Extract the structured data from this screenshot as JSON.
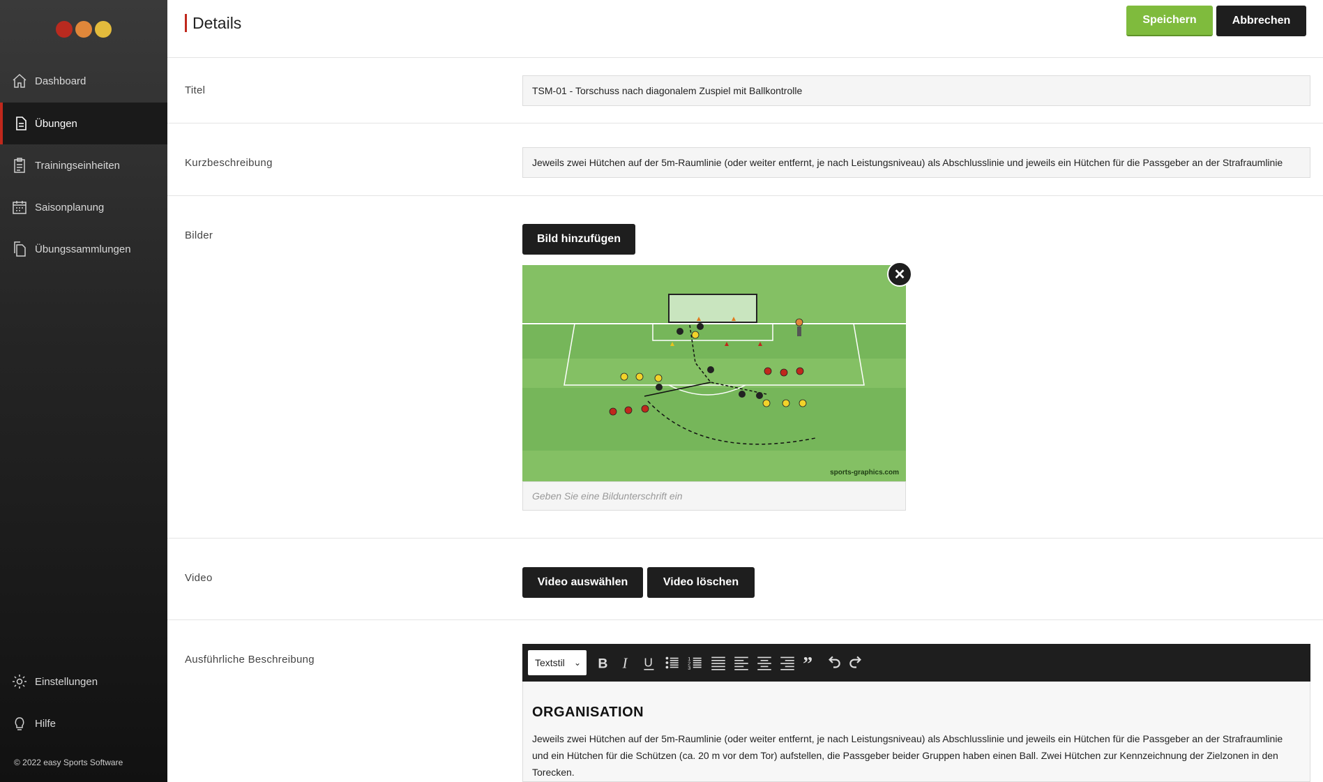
{
  "brand": {
    "logo_colors": [
      "#c0281c",
      "#e8893a",
      "#e7bd3a"
    ],
    "accent": "#c0281c",
    "save_color": "#7fbb3d"
  },
  "sidebar": {
    "items": [
      {
        "label": "Dashboard",
        "icon": "home-icon"
      },
      {
        "label": "Übungen",
        "icon": "document-icon",
        "active": true
      },
      {
        "label": "Trainingseinheiten",
        "icon": "clipboard-icon"
      },
      {
        "label": "Saisonplanung",
        "icon": "calendar-icon"
      },
      {
        "label": "Übungssammlungen",
        "icon": "copy-icon"
      }
    ],
    "bottom_items": [
      {
        "label": "Einstellungen",
        "icon": "gear-icon"
      },
      {
        "label": "Hilfe",
        "icon": "lightbulb-icon"
      }
    ],
    "footer": "© 2022 easy Sports Software"
  },
  "header": {
    "title": "Details",
    "save_label": "Speichern",
    "cancel_label": "Abbrechen"
  },
  "form": {
    "title_label": "Titel",
    "title_value": "TSM-01 - Torschuss nach diagonalem Zuspiel mit Ballkontrolle",
    "short_label": "Kurzbeschreibung",
    "short_value": "Jeweils zwei Hütchen auf der 5m-Raumlinie (oder weiter entfernt, je nach Leistungsniveau) als Abschlusslinie und jeweils ein Hütchen für die Passgeber an der Strafraumlinie",
    "images_label": "Bilder",
    "add_image_label": "Bild hinzufügen",
    "image_watermark": "sports-graphics.com",
    "caption_placeholder": "Geben Sie eine Bildunterschrift ein",
    "video_label": "Video",
    "video_select_label": "Video auswählen",
    "video_delete_label": "Video löschen",
    "long_label": "Ausführliche Beschreibung"
  },
  "editor": {
    "style_select": "Textstil",
    "toolbar_icons": [
      "bold-icon",
      "italic-icon",
      "underline-icon",
      "bullet-list-icon",
      "numbered-list-icon",
      "align-justify-icon",
      "align-left-icon",
      "align-center-icon",
      "align-right-icon",
      "quote-icon",
      "undo-icon",
      "redo-icon"
    ],
    "heading": "ORGANISATION",
    "paragraph": "Jeweils zwei Hütchen auf der 5m-Raumlinie (oder weiter entfernt, je nach Leistungsniveau) als Abschlusslinie und jeweils ein Hütchen für die Passgeber an der Strafraumlinie und ein Hütchen für die Schützen (ca. 20 m vor dem Tor) aufstellen, die Passgeber beider Gruppen haben einen Ball. Zwei Hütchen zur Kennzeichnung der Zielzonen in den Torecken."
  }
}
